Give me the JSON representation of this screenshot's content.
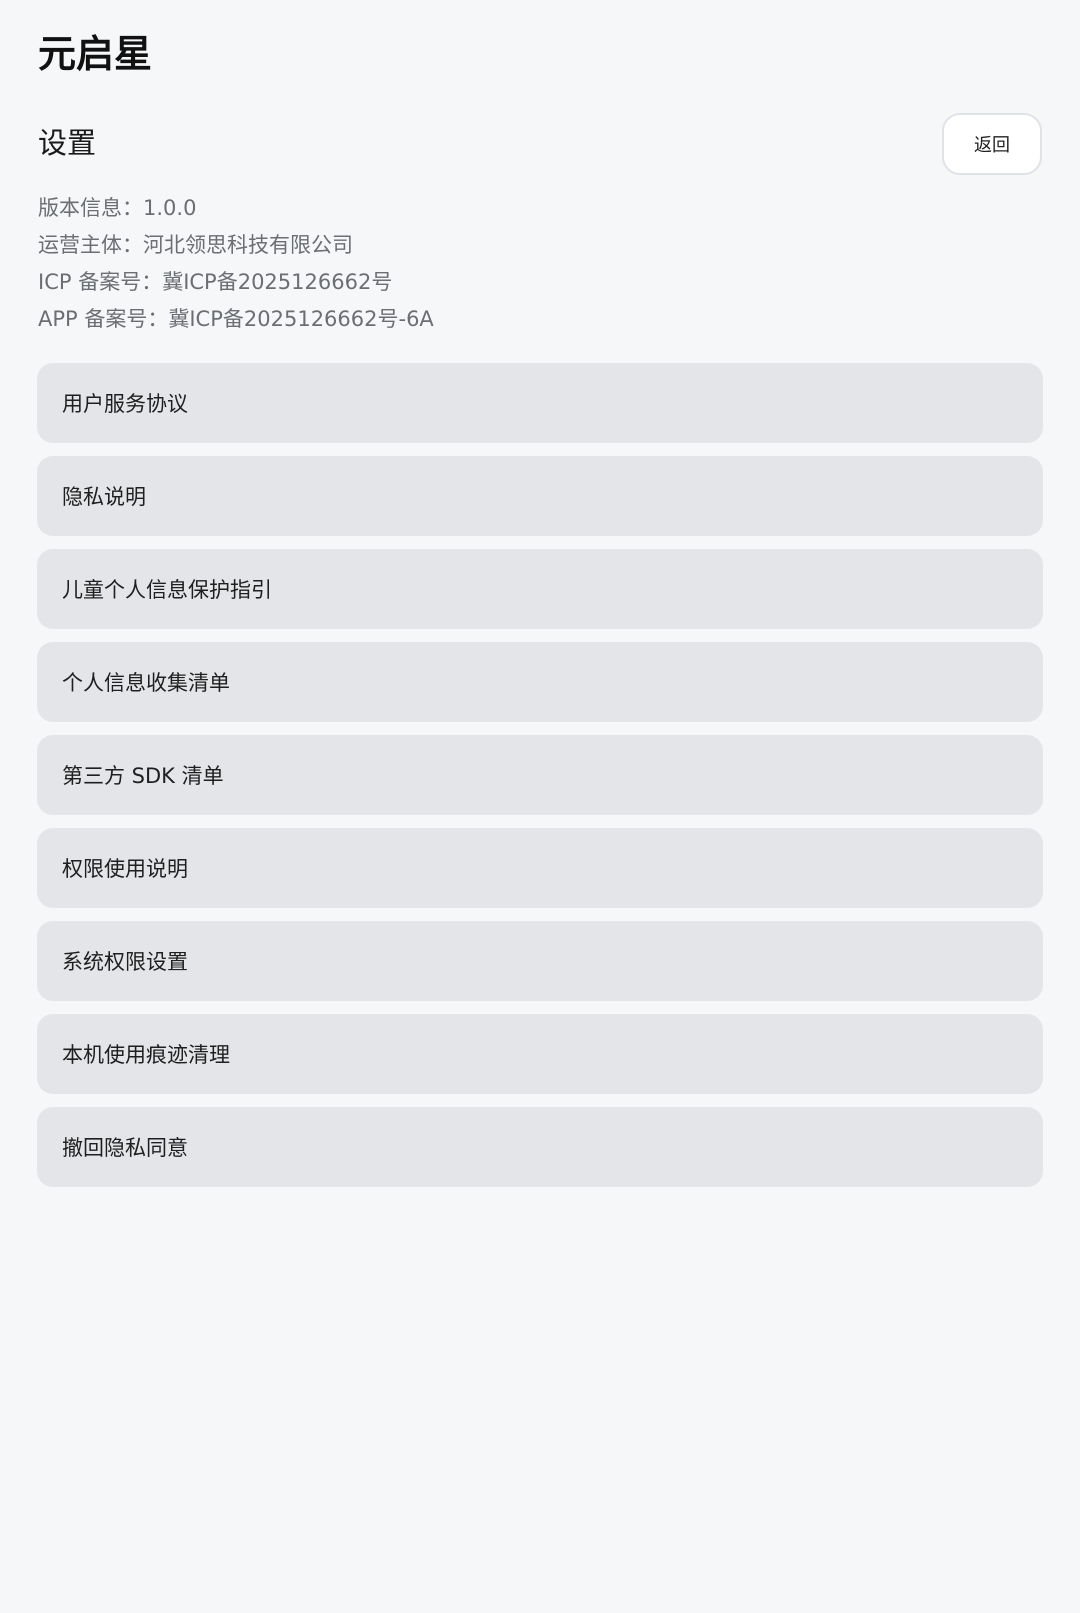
{
  "app": {
    "title": "元启星"
  },
  "header": {
    "title": "设置",
    "back_label": "返回"
  },
  "info": {
    "version": "版本信息：1.0.0",
    "operator": "运营主体：河北领思科技有限公司",
    "icp": "ICP 备案号：冀ICP备2025126662号",
    "app_record": "APP 备案号：冀ICP备2025126662号-6A"
  },
  "menu": {
    "items": [
      {
        "label": "用户服务协议"
      },
      {
        "label": "隐私说明"
      },
      {
        "label": "儿童个人信息保护指引"
      },
      {
        "label": "个人信息收集清单"
      },
      {
        "label": "第三方 SDK 清单"
      },
      {
        "label": "权限使用说明"
      },
      {
        "label": "系统权限设置"
      },
      {
        "label": "本机使用痕迹清理"
      },
      {
        "label": "撤回隐私同意"
      }
    ]
  },
  "colors": {
    "background": "#f6f7f9",
    "menu_item_bg": "#e3e5e8",
    "info_text": "#6b6e73",
    "button_border": "#dfe3e8"
  }
}
